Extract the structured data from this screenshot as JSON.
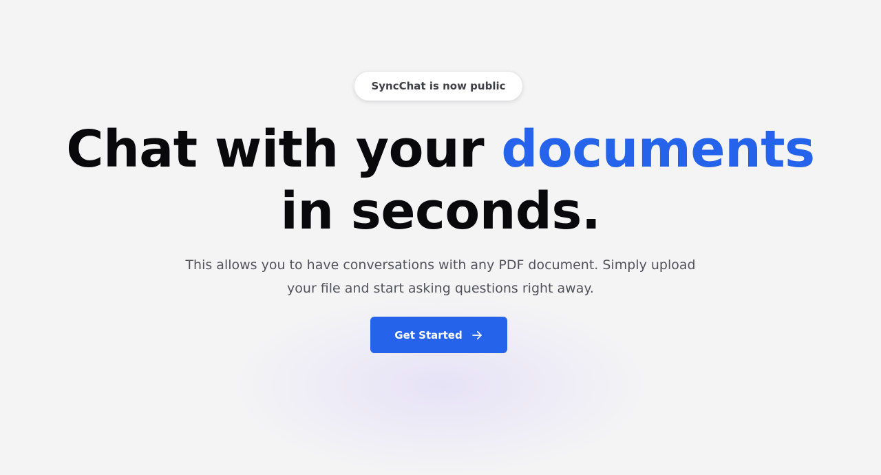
{
  "announcement": {
    "label": "SyncChat is now public"
  },
  "hero": {
    "headline_part1": "Chat with your ",
    "headline_highlight": "documents",
    "headline_line2": "in seconds.",
    "subtitle_line1": "This allows you to have conversations with any PDF document. Simply upload",
    "subtitle_line2": "your file and start asking questions right away."
  },
  "cta": {
    "label": "Get Started",
    "icon": "arrow-right-icon"
  },
  "colors": {
    "background": "#f4f4f5",
    "accent": "#2563eb",
    "headline": "#09090b",
    "subtitle": "#52525b",
    "badge_text": "#3f3f46"
  }
}
